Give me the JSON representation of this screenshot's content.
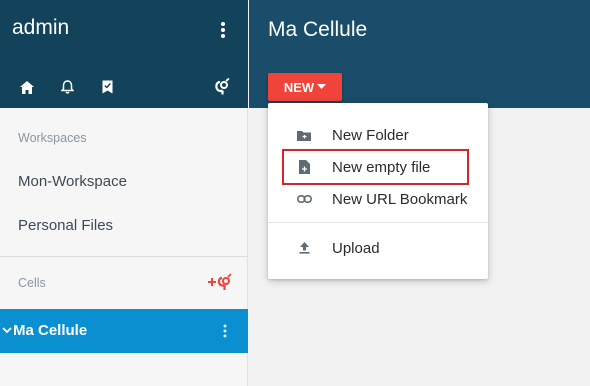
{
  "sidebar": {
    "user_name": "admin",
    "header_icons": [
      "home-icon",
      "bell-icon",
      "bookmark-icon",
      "cells-switch-icon"
    ],
    "workspaces_title": "Workspaces",
    "workspaces": [
      {
        "label": "Mon-Workspace"
      },
      {
        "label": "Personal Files"
      }
    ],
    "cells_title": "Cells",
    "cells": [
      {
        "label": "Ma Cellule",
        "selected": true
      }
    ]
  },
  "main": {
    "title": "Ma Cellule",
    "new_button_label": "NEW"
  },
  "new_menu": {
    "items": [
      {
        "label": "New Folder",
        "icon": "folder-plus-icon"
      },
      {
        "label": "New empty file",
        "icon": "file-plus-icon",
        "highlighted": true
      },
      {
        "label": "New URL Bookmark",
        "icon": "link-icon"
      },
      {
        "label": "Upload",
        "icon": "upload-icon"
      }
    ]
  },
  "colors": {
    "sidebar_header": "#12435a",
    "main_header": "#1a4d69",
    "new_button": "#f0433a",
    "selected_cell": "#0a8fd0",
    "highlight_border": "#d3242f",
    "cells_add_icon": "#f0433a"
  }
}
